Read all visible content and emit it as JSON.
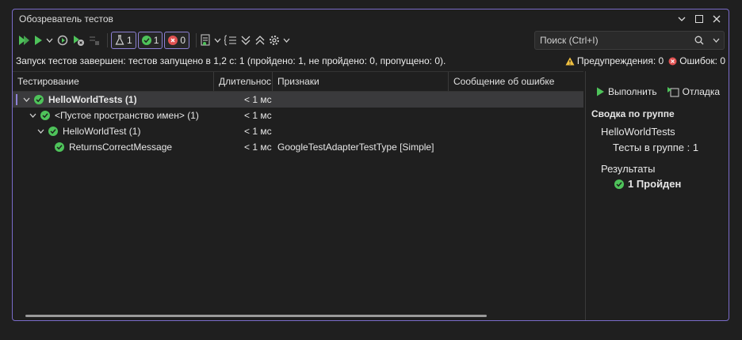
{
  "window": {
    "title": "Обозреватель тестов"
  },
  "toolbar": {
    "badges": {
      "total": "1",
      "passed": "1",
      "failed": "0"
    }
  },
  "search": {
    "placeholder": "Поиск (Ctrl+I)"
  },
  "status": {
    "summary": "Запуск тестов завершен: тестов запущено в 1,2 с: 1 (пройдено: 1, не пройдено: 0, пропущено: 0).",
    "warnings": "Предупреждения: 0",
    "errors": "Ошибок: 0"
  },
  "grid": {
    "columns": [
      "Тестирование",
      "Длительнос",
      "Признаки",
      "Сообщение об ошибке"
    ],
    "rows": [
      {
        "name": "HelloWorldTests  (1)",
        "duration": "< 1 мс",
        "traits": ""
      },
      {
        "name": "<Пустое пространство имен>  (1)",
        "duration": "< 1 мс",
        "traits": ""
      },
      {
        "name": "HelloWorldTest  (1)",
        "duration": "< 1 мс",
        "traits": ""
      },
      {
        "name": "ReturnsCorrectMessage",
        "duration": "< 1 мс",
        "traits": "GoogleTestAdapterTestType [Simple]"
      }
    ]
  },
  "side": {
    "run_label": "Выполнить",
    "debug_label": "Отладка",
    "summary_heading": "Сводка по группе",
    "group_name": "HelloWorldTests",
    "tests_in_group": "Тесты в группе : 1",
    "results_heading": "Результаты",
    "passed_result": "1 Пройден"
  },
  "colors": {
    "accent": "#8e82d6",
    "pass": "#4ec35a",
    "fail": "#e05252",
    "warn": "#f0c040"
  }
}
